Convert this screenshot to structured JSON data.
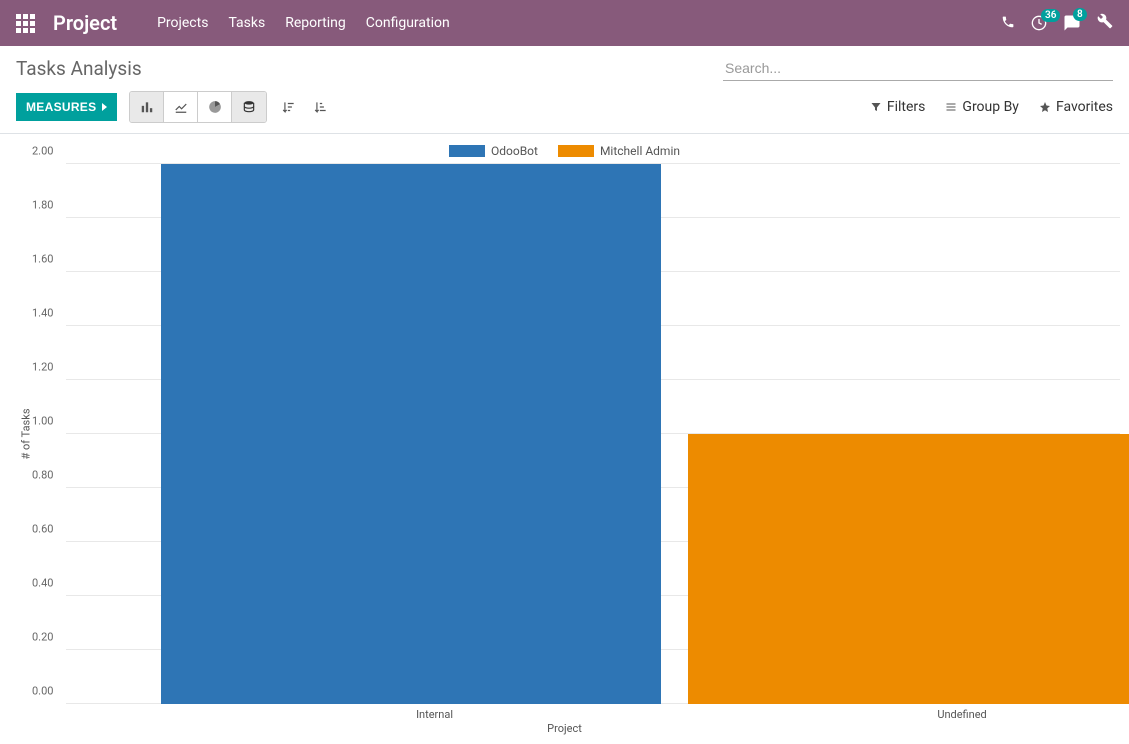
{
  "brand": "Project",
  "nav": {
    "items": [
      "Projects",
      "Tasks",
      "Reporting",
      "Configuration"
    ]
  },
  "topright": {
    "clock_badge": "36",
    "chat_badge": "8"
  },
  "page_title": "Tasks Analysis",
  "search": {
    "placeholder": "Search..."
  },
  "measures_label": "MEASURES",
  "filters_label": "Filters",
  "groupby_label": "Group By",
  "favorites_label": "Favorites",
  "colors": {
    "series1": "#2e75b5",
    "series2": "#ed8b00",
    "measures": "#00a09d"
  },
  "chart_data": {
    "type": "bar",
    "title": "",
    "xlabel": "Project",
    "ylabel": "# of Tasks",
    "ylim": [
      0,
      2.0
    ],
    "yticks": [
      "0.00",
      "0.20",
      "0.40",
      "0.60",
      "0.80",
      "1.00",
      "1.20",
      "1.40",
      "1.60",
      "1.80",
      "2.00"
    ],
    "categories": [
      "Internal",
      "Undefined"
    ],
    "series": [
      {
        "name": "OdooBot",
        "values": [
          2.0,
          0
        ]
      },
      {
        "name": "Mitchell Admin",
        "values": [
          0,
          1.0
        ]
      }
    ]
  }
}
